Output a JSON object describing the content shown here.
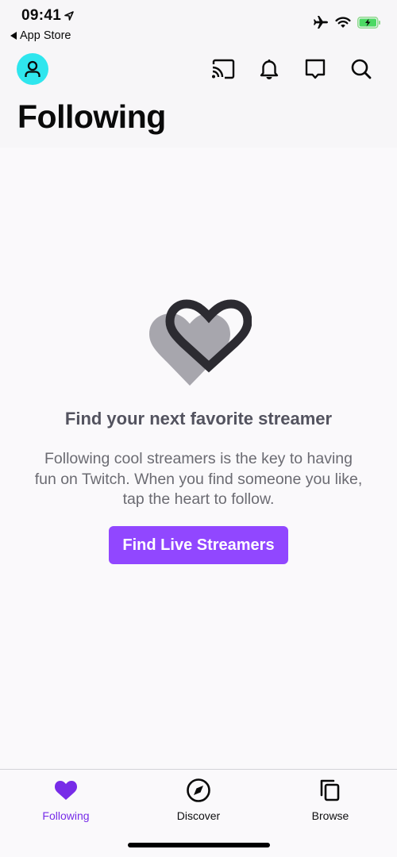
{
  "status_bar": {
    "time": "09:41",
    "back_app": "App Store",
    "icons": [
      "location-arrow-icon",
      "airplane-icon",
      "wifi-icon",
      "battery-charging-icon"
    ],
    "battery_color": "#4cd964"
  },
  "header": {
    "avatar_icon": "user-icon",
    "avatar_color": "#2fe6ee",
    "actions": [
      {
        "name": "cast",
        "icon": "cast-icon"
      },
      {
        "name": "notifications",
        "icon": "bell-icon"
      },
      {
        "name": "whispers",
        "icon": "chat-icon"
      },
      {
        "name": "search",
        "icon": "search-icon"
      }
    ],
    "title": "Following"
  },
  "empty_state": {
    "illustration": "hearts-icon",
    "title": "Find your next favorite streamer",
    "description": "Following cool streamers is the key to having fun on Twitch. When you find someone you like, tap the heart to follow.",
    "cta_label": "Find Live Streamers",
    "cta_color": "#9147ff"
  },
  "tabbar": {
    "tabs": [
      {
        "label": "Following",
        "icon": "heart-icon",
        "active": true
      },
      {
        "label": "Discover",
        "icon": "compass-icon",
        "active": false
      },
      {
        "label": "Browse",
        "icon": "copy-icon",
        "active": false
      }
    ],
    "active_color": "#772ce8"
  }
}
